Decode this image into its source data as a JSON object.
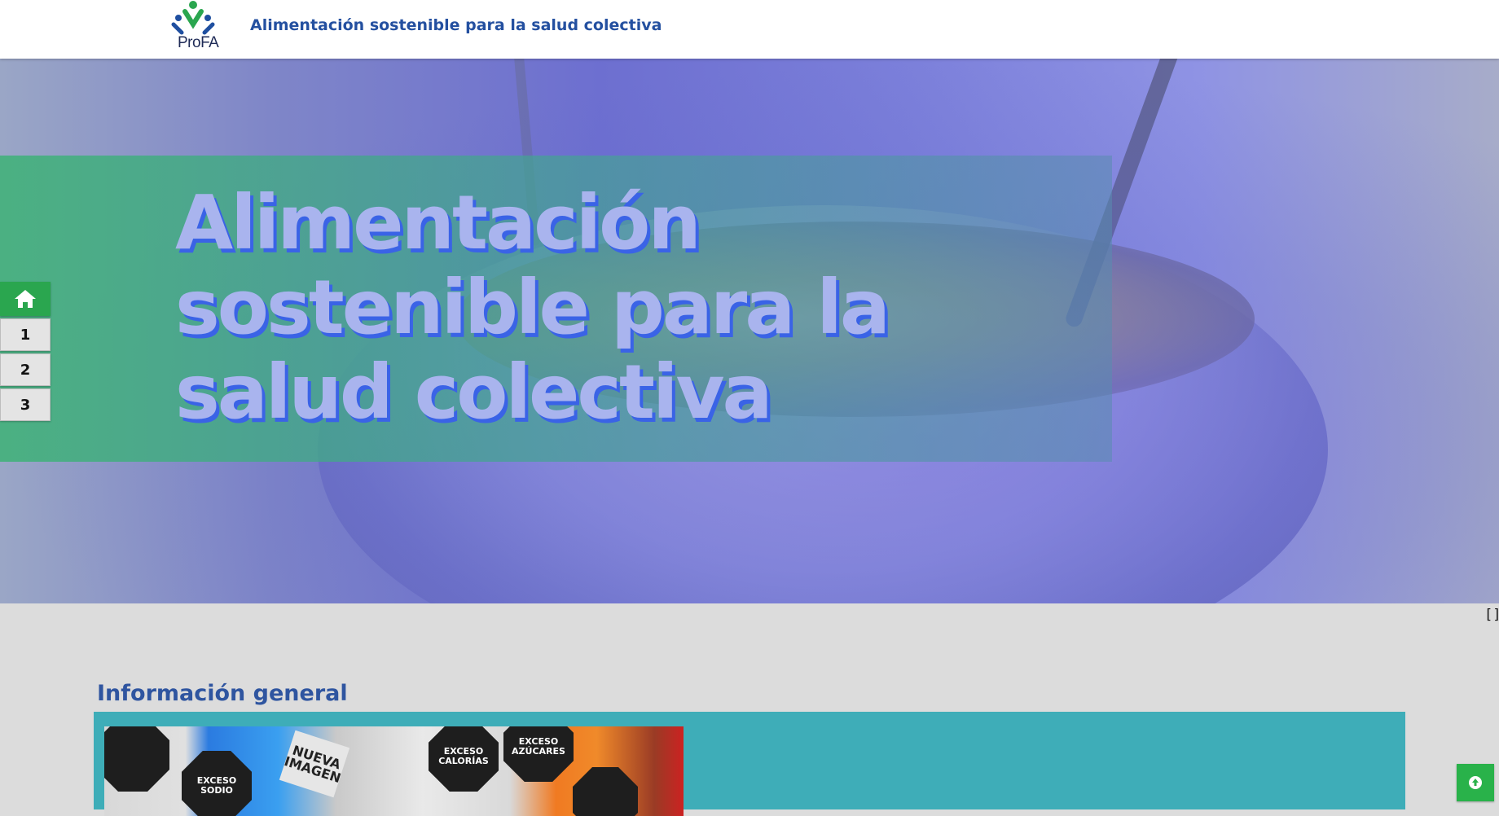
{
  "header": {
    "logo_text": "ProFA",
    "site_title": "Alimentación sostenible para la salud colectiva"
  },
  "hero": {
    "title": "Alimentación sostenible para la salud colectiva"
  },
  "side_nav": {
    "home_icon": "home-icon",
    "items": [
      "1",
      "2",
      "3"
    ]
  },
  "fullscreen_toggle": "[]",
  "main": {
    "section_heading": "Información general",
    "image_labels": {
      "left_octagon": "EXCESO SODIO",
      "tag": "NUEVA IMAGEN",
      "octagon_1": "EXCESO CALORÍAS",
      "octagon_2": "EXCESO AZÚCARES"
    }
  },
  "back_to_top_icon": "arrow-up-circle-icon",
  "colors": {
    "header_title": "#2450a0",
    "hero_band": "#3db276",
    "hero_text": "#a9b4ee",
    "hero_text_shadow": "#3a63e6",
    "nav_home": "#2aa64f",
    "section_heading": "#2f55a0",
    "info_panel": "#3eadb8",
    "back_to_top": "#29b24a"
  }
}
